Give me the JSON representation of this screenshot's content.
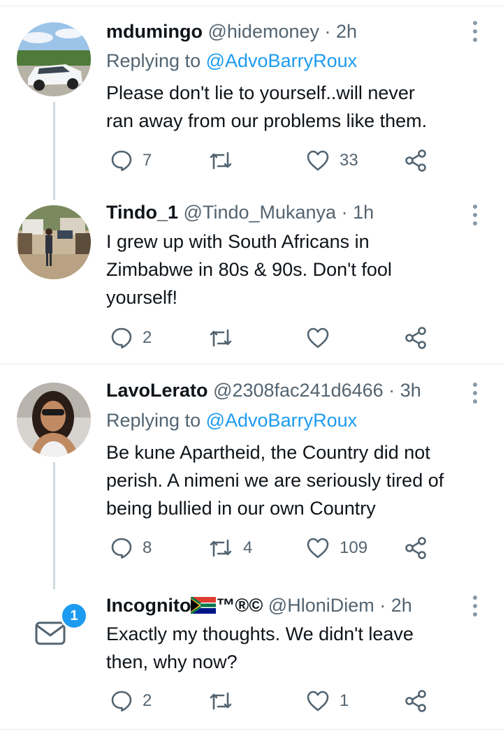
{
  "colors": {
    "accent": "#1d9bf0",
    "secondary_text": "#536471",
    "primary_text": "#0f1419",
    "divider": "#e6e9ec"
  },
  "tweets": [
    {
      "display_name": "mdumingo",
      "handle": "@hidemoney",
      "time": "· 2h",
      "replying_prefix": "Replying to",
      "replying_to": "@AdvoBarryRoux",
      "lines": [
        "Please don't lie to yourself..will never",
        "ran away from our problems like them."
      ],
      "replies": "7",
      "retweets": "",
      "likes": "33"
    },
    {
      "display_name": "Tindo_1",
      "handle": "@Tindo_Mukanya",
      "time": "· 1h",
      "lines": [
        "I grew up with South Africans in",
        "Zimbabwe in 80s & 90s. Don't fool",
        "yourself!"
      ],
      "replies": "2",
      "retweets": "",
      "likes": ""
    },
    {
      "display_name": "LavoLerato",
      "handle": "@2308fac241d6466",
      "time": "· 3h",
      "replying_prefix": "Replying to",
      "replying_to": "@AdvoBarryRoux",
      "lines": [
        "Be kune Apartheid, the Country did not",
        "perish. A nimeni we are seriously tired of",
        "being bullied in our own Country"
      ],
      "replies": "8",
      "retweets": "4",
      "likes": "109"
    },
    {
      "display_name": "Incognito",
      "name_suffix": "™®©",
      "handle": "@HloniDiem",
      "time": "· 2h",
      "lines": [
        "Exactly my thoughts. We didn't leave",
        "then, why now?"
      ],
      "replies": "2",
      "retweets": "",
      "likes": "1"
    }
  ],
  "messages_badge": "1",
  "icons": [
    "reply-icon",
    "retweet-icon",
    "like-icon",
    "share-icon",
    "more-icon",
    "mail-icon",
    "south-africa-flag-icon"
  ]
}
